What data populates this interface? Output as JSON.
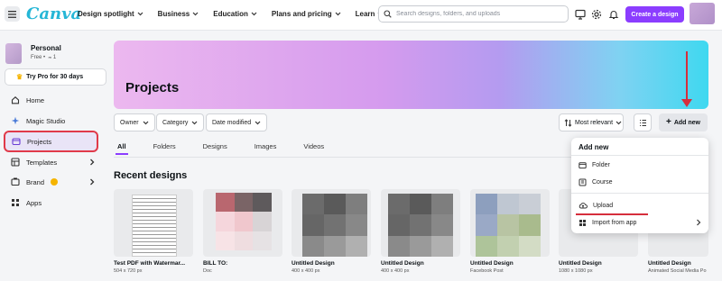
{
  "topbar": {
    "logo": "Canva",
    "nav": [
      "Design spotlight",
      "Business",
      "Education",
      "Plans and pricing",
      "Learn"
    ],
    "search_placeholder": "Search designs, folders, and uploads",
    "create_label": "Create a design",
    "icons": [
      "monitor-icon",
      "gear-icon",
      "bell-icon"
    ]
  },
  "sidebar": {
    "team_name": "Personal",
    "team_sub": "Free •  ₘ 1",
    "pro_label": "Try Pro for 30 days",
    "items": [
      {
        "label": "Home",
        "icon": "home-icon"
      },
      {
        "label": "Magic Studio",
        "icon": "sparkle-icon"
      },
      {
        "label": "Projects",
        "icon": "folder-icon",
        "active": true
      },
      {
        "label": "Templates",
        "icon": "templates-icon"
      },
      {
        "label": "Brand",
        "icon": "brand-icon"
      },
      {
        "label": "Apps",
        "icon": "apps-icon"
      }
    ]
  },
  "main": {
    "banner_title": "Projects",
    "filters": [
      "Owner",
      "Category",
      "Date modified"
    ],
    "sort_label": "Most relevant",
    "add_new_label": "Add new",
    "tabs": [
      "All",
      "Folders",
      "Designs",
      "Images",
      "Videos"
    ],
    "section_title": "Recent designs",
    "cards": [
      {
        "title": "Test PDF with Watermar...",
        "sub": "504 x 720 px"
      },
      {
        "title": "BILL TO:",
        "sub": "Doc"
      },
      {
        "title": "Untitled Design",
        "sub": "400 x 400 px"
      },
      {
        "title": "Untitled Design",
        "sub": "400 x 400 px"
      },
      {
        "title": "Untitled Design",
        "sub": "Facebook Post"
      },
      {
        "title": "Untitled Design",
        "sub": "1080 x 1080 px"
      },
      {
        "title": "Untitled Design",
        "sub": "Animated Social Media Po"
      }
    ]
  },
  "dropdown": {
    "header": "Add new",
    "items": [
      "Folder",
      "Course",
      "Upload",
      "Import from app"
    ]
  },
  "colors": {
    "accent": "#8b3dff",
    "annotation": "#d62e3c"
  }
}
